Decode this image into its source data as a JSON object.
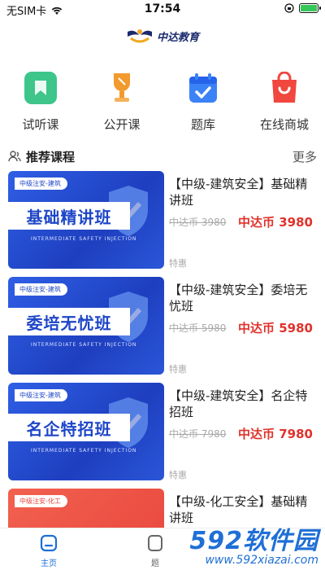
{
  "status_bar": {
    "carrier": "无SIM卡",
    "time": "17:54"
  },
  "brand": {
    "name": "中达教育"
  },
  "quick_nav": [
    {
      "label": "试听课",
      "icon": "bookmark-icon",
      "color": "#3ec58a"
    },
    {
      "label": "公开课",
      "icon": "trophy-icon",
      "color": "#f29a2e"
    },
    {
      "label": "题库",
      "icon": "calendar-check-icon",
      "color": "#3b82f6"
    },
    {
      "label": "在线商城",
      "icon": "shopping-bag-icon",
      "color": "#f0473f"
    }
  ],
  "section": {
    "title": "推荐课程",
    "more": "更多"
  },
  "courses": [
    {
      "tag": "中级注安-建筑",
      "banner": "基础精讲班",
      "banner_en": "INTERMEDIATE SAFETY INJECTION",
      "title": "【中级-建筑安全】基础精讲班",
      "old_price": "中达币 3980",
      "price": "中达币 3980",
      "badge": "特惠"
    },
    {
      "tag": "中级注安-建筑",
      "banner": "委培无忧班",
      "banner_en": "INTERMEDIATE SAFETY INJECTION",
      "title": "【中级-建筑安全】委培无忧班",
      "old_price": "中达币 5980",
      "price": "中达币 5980",
      "badge": "特惠"
    },
    {
      "tag": "中级注安-建筑",
      "banner": "名企特招班",
      "banner_en": "INTERMEDIATE SAFETY INJECTION",
      "title": "【中级-建筑安全】名企特招班",
      "old_price": "中达币 7980",
      "price": "中达币 7980",
      "badge": "特惠"
    },
    {
      "tag": "中级注安-化工",
      "banner": "",
      "banner_en": "",
      "title": "【中级-化工安全】基础精讲班",
      "old_price": "",
      "price": "",
      "badge": ""
    }
  ],
  "tabbar": {
    "home": "主页",
    "second": "题"
  },
  "watermark": {
    "top": "592软件园",
    "url": "www.592xiazai.com"
  },
  "colors": {
    "accent": "#1f6fd6",
    "price": "#e0322b",
    "banner_blue": "#1e46c8",
    "banner_red": "#e8453c"
  }
}
